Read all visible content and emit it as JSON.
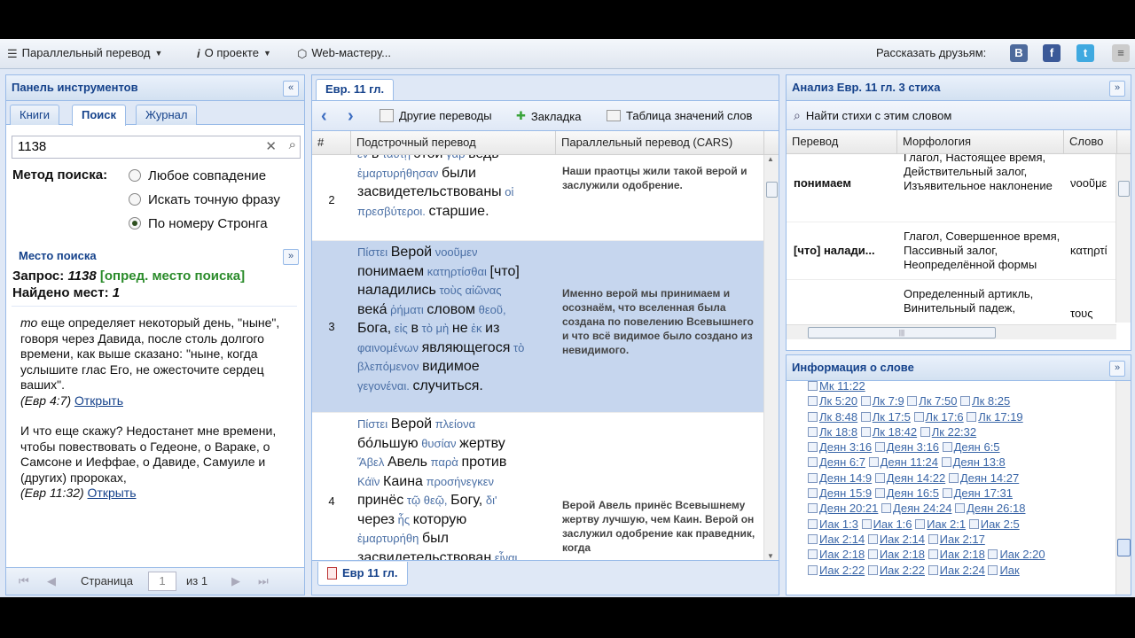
{
  "topbar": {
    "menu_parallel": "Параллельный перевод",
    "menu_about": "О проекте",
    "menu_webmaster": "Web-мастеру...",
    "share_label": "Рассказать друзьям:",
    "social": [
      "B",
      "f",
      "t"
    ]
  },
  "left_panel": {
    "title": "Панель инструментов",
    "tabs": [
      "Книги",
      "Поиск",
      "Журнал"
    ],
    "active_tab": "Поиск",
    "search_value": "1138",
    "method_label": "Метод поиска:",
    "methods": [
      "Любое совпадение",
      "Искать точную фразу",
      "По номеру Стронга"
    ],
    "selected_method": "По номеру Стронга",
    "place_title": "Место поиска",
    "query_label": "Запрос:",
    "query_value": "1138",
    "query_place": "[опред. место поиска]",
    "found_label": "Найдено мест:",
    "found_value": "1",
    "result1_lead": "то",
    "result1_text": " еще определяет некоторый день, \"ныне\", говоря через Давида, после столь долгого времени, как выше сказано: \"ныне, когда услышите глас Его, не ожесточите сердец ваших\".",
    "result1_ref": "(Евр 4:7)",
    "result1_open": "Открыть",
    "result2_text": "И что еще скажу? Недостанет мне времени, чтобы повествовать о Гедеоне, о Вараке, о Самсоне и Иеффае, о Давиде, Самуиле и (других) пророках,",
    "result2_ref": "(Евр 11:32)",
    "result2_open": "Открыть",
    "pager_page": "Страница",
    "pager_value": "1",
    "pager_of": "из 1"
  },
  "center_panel": {
    "tab": "Евр. 11 гл.",
    "toolbar_other": "Другие переводы",
    "toolbar_bookmark": "Закладка",
    "toolbar_table": "Таблица значений слов",
    "col_num": "#",
    "col_interlinear": "Подстрочный перевод",
    "col_parallel": "Параллельный перевод (CARS)",
    "rows": [
      {
        "num": "2",
        "lines": [
          [
            {
              "g": "ἐν"
            },
            {
              "r": "в"
            },
            {
              "g": "ταύτῃ"
            },
            {
              "r": "этой"
            },
            {
              "g": "γὰρ"
            },
            {
              "r": "ведь"
            }
          ],
          [
            {
              "g": "ἐμαρτυρήθησαν"
            },
            {
              "r": "были"
            }
          ],
          [
            {
              "r": "засвидетельствованы"
            },
            {
              "g": "οἱ"
            }
          ],
          [
            {
              "g": "πρεσβύτεροι."
            },
            {
              "r": "старшие."
            }
          ]
        ],
        "parallel": "Наши праотцы жили такой верой и заслужили одобрение."
      },
      {
        "num": "3",
        "lines": [
          [
            {
              "g": "Πίστει"
            },
            {
              "r": "Верой"
            },
            {
              "g": "νοοῦμεν"
            }
          ],
          [
            {
              "r": "понимаем"
            },
            {
              "g": "κατηρτίσθαι"
            },
            {
              "r": "[что]"
            }
          ],
          [
            {
              "r": "наладились"
            },
            {
              "g": "τοὺς αἰῶνας"
            }
          ],
          [
            {
              "r": "века́"
            },
            {
              "g": "ῥήματι"
            },
            {
              "r": "словом"
            },
            {
              "g": "θεοῦ,"
            }
          ],
          [
            {
              "r": "Бога,"
            },
            {
              "g": "εἰς"
            },
            {
              "r": "в"
            },
            {
              "g": "τὸ μὴ"
            },
            {
              "r": "не"
            },
            {
              "g": "ἐκ"
            },
            {
              "r": "из"
            }
          ],
          [
            {
              "g": "φαινομένων"
            },
            {
              "r": "являющегося"
            },
            {
              "g": "τὸ"
            }
          ],
          [
            {
              "g": "βλεπόμενον"
            },
            {
              "r": "видимое"
            }
          ],
          [
            {
              "g": "γεγονέναι."
            },
            {
              "r": "случиться."
            }
          ]
        ],
        "parallel": "Именно верой мы принимаем и осознаём, что вселенная была создана по повелению Всевышнего и что всё видимое было создано из невидимого."
      },
      {
        "num": "4",
        "lines": [
          [
            {
              "g": "Πίστει"
            },
            {
              "r": "Верой"
            },
            {
              "g": "πλείονα"
            }
          ],
          [
            {
              "r": "бо́льшую"
            },
            {
              "g": "θυσίαν"
            },
            {
              "r": "жертву"
            }
          ],
          [
            {
              "g": "Ἅβελ"
            },
            {
              "r": "Авель"
            },
            {
              "g": "παρὰ"
            },
            {
              "r": "против"
            }
          ],
          [
            {
              "g": "Κάϊν"
            },
            {
              "r": "Каина"
            },
            {
              "g": "προσήνεγκεν"
            }
          ],
          [
            {
              "r": "принёс"
            },
            {
              "g": "τῷ θεῷ,"
            },
            {
              "r": "Богу,"
            },
            {
              "g": "δι'"
            }
          ],
          [
            {
              "r": "через"
            },
            {
              "g": "ἧς"
            },
            {
              "r": "которую"
            }
          ],
          [
            {
              "g": "ἐμαρτυρήθη"
            },
            {
              "r": "был"
            }
          ],
          [
            {
              "r": "засвидетельствован"
            },
            {
              "g": "εἶναι"
            }
          ]
        ],
        "parallel": "Верой Авель принёс Всевышнему жертву лучшую, чем Каин. Верой он заслужил одобрение как праведник, когда"
      }
    ],
    "bottom_tab": "Евр 11 гл."
  },
  "right_panel": {
    "analysis_title": "Анализ Евр. 11 гл. 3 стиха",
    "find_verses": "Найти стихи с этим словом",
    "col_translation": "Перевод",
    "col_morph": "Морфология",
    "col_word": "Слово",
    "rows": [
      {
        "tr": "понимаем",
        "morph": "Глагол, Настоящее время, Действительный залог, Изъявительное наклонение",
        "word": "νοοῦμε"
      },
      {
        "tr": "[что] наладились",
        "tr_short": "[что] налади...",
        "morph": "Глагол, Совершенное время, Пассивный залог, Неопределённой формы",
        "word": "κατηρτί"
      },
      {
        "tr": "",
        "morph": "Определенный артикль, Винительный падеж,",
        "word": "τους"
      }
    ],
    "info_title": "Информация о слове",
    "refs": [
      [
        "Мк 11:22"
      ],
      [
        "Лк 5:20",
        "Лк 7:9",
        "Лк 7:50",
        "Лк 8:25"
      ],
      [
        "Лк 8:48",
        "Лк 17:5",
        "Лк 17:6",
        "Лк 17:19"
      ],
      [
        "Лк 18:8",
        "Лк 18:42",
        "Лк 22:32"
      ],
      [
        "Деян 3:16",
        "Деян 3:16",
        "Деян 6:5"
      ],
      [
        "Деян 6:7",
        "Деян 11:24",
        "Деян 13:8"
      ],
      [
        "Деян 14:9",
        "Деян 14:22",
        "Деян 14:27"
      ],
      [
        "Деян 15:9",
        "Деян 16:5",
        "Деян 17:31"
      ],
      [
        "Деян 20:21",
        "Деян 24:24",
        "Деян 26:18"
      ],
      [
        "Иак 1:3",
        "Иак 1:6",
        "Иак 2:1",
        "Иак 2:5"
      ],
      [
        "Иак 2:14",
        "Иак 2:14",
        "Иак 2:17"
      ],
      [
        "Иак 2:18",
        "Иак 2:18",
        "Иак 2:18",
        "Иак 2:20"
      ],
      [
        "Иак 2:22",
        "Иак 2:22",
        "Иак 2:24",
        "Иак"
      ]
    ]
  }
}
